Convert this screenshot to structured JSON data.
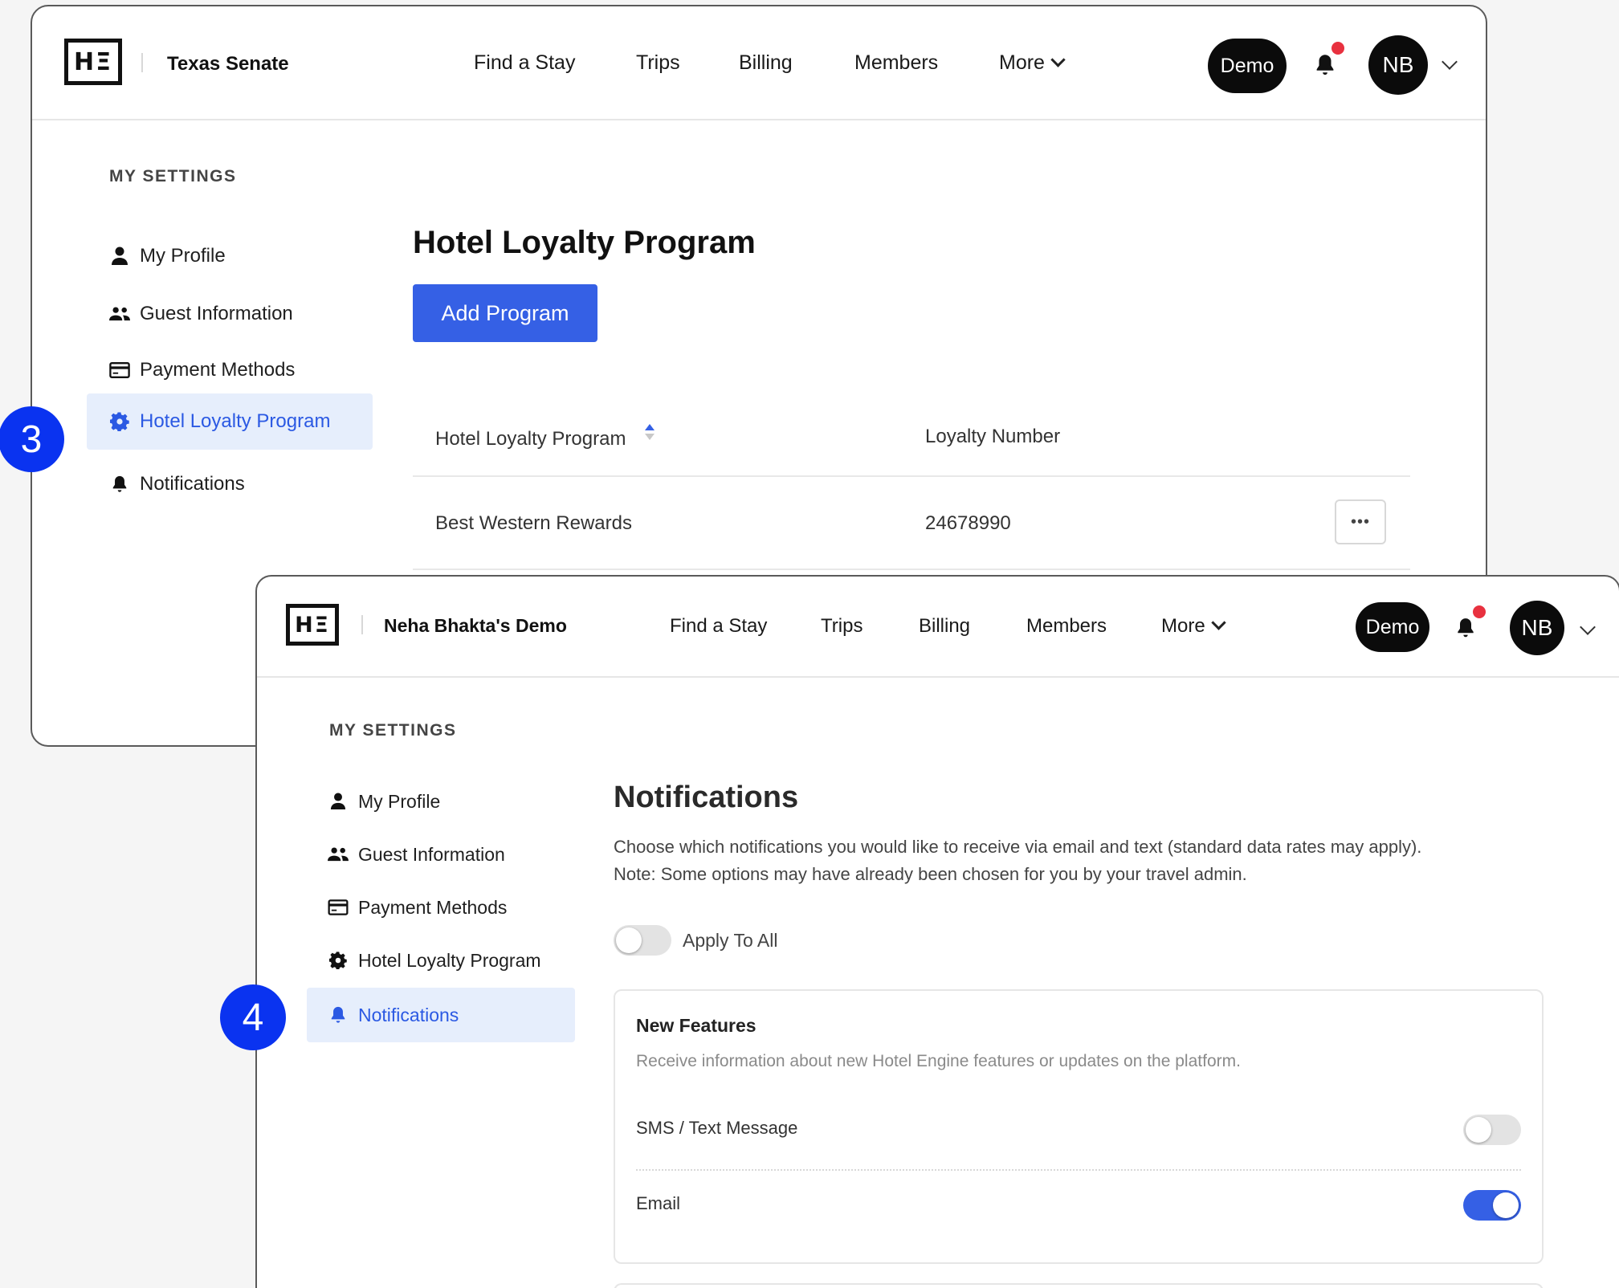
{
  "window1": {
    "org_name": "Texas Senate",
    "logo_text": "HΞ",
    "nav": [
      "Find a Stay",
      "Trips",
      "Billing",
      "Members",
      "More"
    ],
    "demo_label": "Demo",
    "avatar_initials": "NB",
    "sidebar_heading": "MY SETTINGS",
    "sidebar": [
      "My Profile",
      "Guest Information",
      "Payment Methods",
      "Hotel Loyalty Program",
      "Notifications"
    ],
    "active_item": "Hotel Loyalty Program",
    "page_title": "Hotel Loyalty Program",
    "add_button": "Add Program",
    "table": {
      "headers": [
        "Hotel Loyalty Program",
        "Loyalty Number"
      ],
      "rows": [
        {
          "program": "Best Western Rewards",
          "number": "24678990",
          "actions": "•••"
        }
      ]
    }
  },
  "window2": {
    "org_name": "Neha Bhakta's Demo",
    "logo_text": "HΞ",
    "nav": [
      "Find a Stay",
      "Trips",
      "Billing",
      "Members",
      "More"
    ],
    "demo_label": "Demo",
    "avatar_initials": "NB",
    "sidebar_heading": "MY SETTINGS",
    "sidebar": [
      "My Profile",
      "Guest Information",
      "Payment Methods",
      "Hotel Loyalty Program",
      "Notifications"
    ],
    "active_item": "Notifications",
    "page_title": "Notifications",
    "description_line1": "Choose which notifications you would like to receive via email and text (standard data rates may apply).",
    "description_line2": "Note: Some options may have already been chosen for you by your travel admin.",
    "apply_all_label": "Apply To All",
    "apply_all_on": false,
    "card": {
      "title": "New Features",
      "subtitle": "Receive information about new Hotel Engine features or updates on the platform.",
      "options": [
        {
          "label": "SMS / Text Message",
          "on": false
        },
        {
          "label": "Email",
          "on": true
        }
      ]
    }
  },
  "steps": [
    "3",
    "4"
  ],
  "colors": {
    "accent": "#3560e5",
    "active_bg": "#e6eefc",
    "step_badge": "#0a33f0",
    "notification_dot": "#e8313f"
  },
  "icons": {
    "profile": "person-icon",
    "guests": "people-icon",
    "payment": "credit-card-icon",
    "loyalty": "gear-icon",
    "notifications": "bell-icon"
  }
}
